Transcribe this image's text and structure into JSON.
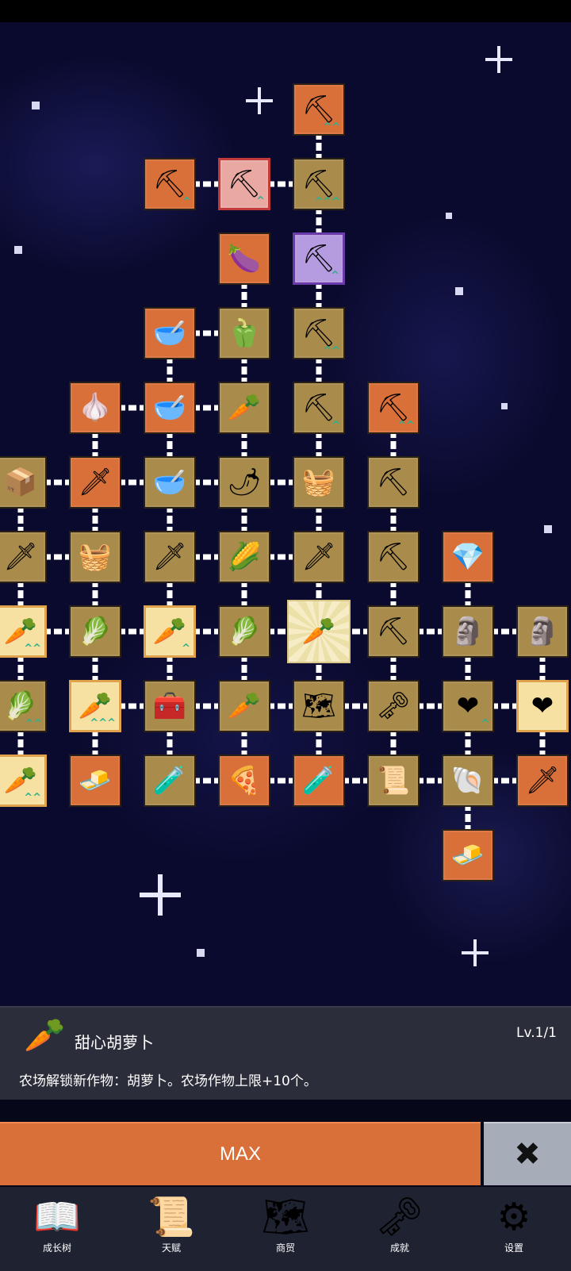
{
  "colors": {
    "node_orange": "#d9703a",
    "node_brown": "#a98b4b",
    "upgrade_arrow": "#2fb08f",
    "panel_bg": "#2b2d3a",
    "max_button": "#d9703a",
    "close_button": "#a7adb8",
    "nav_bg": "#1f2230"
  },
  "tree_nodes": [
    {
      "icon": "shovel-icon",
      "glyph": "⛏",
      "color": "orange",
      "marker": "^^"
    },
    {
      "icon": "shovel-icon",
      "glyph": "⛏",
      "color": "orange",
      "marker": "^"
    },
    {
      "icon": "shovel-icon",
      "glyph": "⛏",
      "color": "pink",
      "marker": "^"
    },
    {
      "icon": "shovel-icon",
      "glyph": "⛏",
      "color": "brown",
      "marker": "^^^"
    },
    {
      "icon": "eggplant-icon",
      "glyph": "🍆",
      "color": "orange",
      "marker": ""
    },
    {
      "icon": "shovel-icon",
      "glyph": "⛏",
      "color": "purple",
      "marker": "^"
    },
    {
      "icon": "bowl-icon",
      "glyph": "🥣",
      "color": "orange",
      "marker": ""
    },
    {
      "icon": "pepper-icon",
      "glyph": "🫑",
      "color": "brown",
      "marker": ""
    },
    {
      "icon": "shovel-icon",
      "glyph": "⛏",
      "color": "brown",
      "marker": "^^"
    },
    {
      "icon": "garlic-icon",
      "glyph": "🧄",
      "color": "orange",
      "marker": ""
    },
    {
      "icon": "bowl-icon",
      "glyph": "🥣",
      "color": "orange",
      "marker": ""
    },
    {
      "icon": "radish-icon",
      "glyph": "🥕",
      "color": "brown",
      "marker": ""
    },
    {
      "icon": "shovel-icon",
      "glyph": "⛏",
      "color": "brown",
      "marker": "^"
    },
    {
      "icon": "pickaxe-icon",
      "glyph": "⛏",
      "color": "orange",
      "marker": "^^"
    },
    {
      "icon": "crate-icon",
      "glyph": "📦",
      "color": "brown",
      "marker": ""
    },
    {
      "icon": "sword-icon",
      "glyph": "🗡",
      "color": "orange",
      "marker": ""
    },
    {
      "icon": "bowl-icon",
      "glyph": "🥣",
      "color": "brown",
      "marker": ""
    },
    {
      "icon": "chili-icon",
      "glyph": "🌶",
      "color": "brown",
      "marker": ""
    },
    {
      "icon": "chest-icon",
      "glyph": "🧺",
      "color": "brown",
      "marker": ""
    },
    {
      "icon": "pickaxe-icon",
      "glyph": "⛏",
      "color": "brown",
      "marker": ""
    },
    {
      "icon": "sword-icon",
      "glyph": "🗡",
      "color": "brown",
      "marker": ""
    },
    {
      "icon": "chest-icon",
      "glyph": "🧺",
      "color": "brown",
      "marker": ""
    },
    {
      "icon": "sword-icon",
      "glyph": "🗡",
      "color": "brown",
      "marker": ""
    },
    {
      "icon": "corn-icon",
      "glyph": "🌽",
      "color": "brown",
      "marker": ""
    },
    {
      "icon": "dagger-icon",
      "glyph": "🗡",
      "color": "brown",
      "marker": ""
    },
    {
      "icon": "pickaxe-icon",
      "glyph": "⛏",
      "color": "brown",
      "marker": ""
    },
    {
      "icon": "crystal-icon",
      "glyph": "💎",
      "color": "orange",
      "marker": ""
    },
    {
      "icon": "carrot-icon",
      "glyph": "🥕",
      "color": "gold",
      "marker": "^^"
    },
    {
      "icon": "cabbage-icon",
      "glyph": "🥬",
      "color": "brown",
      "marker": ""
    },
    {
      "icon": "carrot-icon",
      "glyph": "🥕",
      "color": "gold",
      "marker": "^"
    },
    {
      "icon": "cabbage-icon",
      "glyph": "🥬",
      "color": "brown",
      "marker": ""
    },
    {
      "icon": "carrot-icon",
      "glyph": "🥕",
      "color": "selected",
      "marker": ""
    },
    {
      "icon": "pickaxe-icon",
      "glyph": "⛏",
      "color": "brown",
      "marker": ""
    },
    {
      "icon": "statue-icon",
      "glyph": "🗿",
      "color": "brown",
      "marker": ""
    },
    {
      "icon": "statue-icon",
      "glyph": "🗿",
      "color": "brown",
      "marker": ""
    },
    {
      "icon": "cabbage-icon",
      "glyph": "🥬",
      "color": "brown",
      "marker": "^^"
    },
    {
      "icon": "carrot-icon",
      "glyph": "🥕",
      "color": "gold",
      "marker": "^^^"
    },
    {
      "icon": "treasure-chest-icon",
      "glyph": "🧰",
      "color": "brown",
      "marker": ""
    },
    {
      "icon": "parsnip-icon",
      "glyph": "🥕",
      "color": "brown",
      "marker": ""
    },
    {
      "icon": "map-icon",
      "glyph": "🗺",
      "color": "brown",
      "marker": ""
    },
    {
      "icon": "key-icon",
      "glyph": "🗝",
      "color": "brown",
      "marker": ""
    },
    {
      "icon": "heart-icon",
      "glyph": "❤",
      "color": "brown",
      "marker": "^"
    },
    {
      "icon": "heart-icon",
      "glyph": "❤",
      "color": "gold",
      "marker": ""
    },
    {
      "icon": "carrot-icon",
      "glyph": "🥕",
      "color": "gold",
      "marker": "^^"
    },
    {
      "icon": "gold-bar-icon",
      "glyph": "🧈",
      "color": "orange",
      "marker": ""
    },
    {
      "icon": "potion-icon",
      "glyph": "🧪",
      "color": "brown",
      "marker": ""
    },
    {
      "icon": "pizza-icon",
      "glyph": "🍕",
      "color": "orange",
      "marker": ""
    },
    {
      "icon": "potion-icon",
      "glyph": "🧪",
      "color": "orange",
      "marker": ""
    },
    {
      "icon": "scroll-icon",
      "glyph": "📜",
      "color": "brown",
      "marker": ""
    },
    {
      "icon": "fossil-icon",
      "glyph": "🐚",
      "color": "brown",
      "marker": ""
    },
    {
      "icon": "sword-icon",
      "glyph": "🗡",
      "color": "orange",
      "marker": ""
    },
    {
      "icon": "gold-bar-icon",
      "glyph": "🧈",
      "color": "orange",
      "marker": ""
    }
  ],
  "selected_skill": {
    "icon": "carrot-icon",
    "glyph": "🥕",
    "name": "甜心胡萝卜",
    "level": "Lv.1/1",
    "description": "农场解锁新作物：胡萝卜。农场作物上限+10个。"
  },
  "actions": {
    "max_label": "MAX",
    "close_glyph": "✖",
    "close_icon": "close-icon"
  },
  "nav": [
    {
      "label": "成长树",
      "icon": "book-icon",
      "glyph": "📖"
    },
    {
      "label": "天赋",
      "icon": "scroll-icon",
      "glyph": "📜"
    },
    {
      "label": "商贸",
      "icon": "map-icon",
      "glyph": "🗺"
    },
    {
      "label": "成就",
      "icon": "key-icon",
      "glyph": "🗝"
    },
    {
      "label": "设置",
      "icon": "gear-icon",
      "glyph": "⚙"
    }
  ]
}
